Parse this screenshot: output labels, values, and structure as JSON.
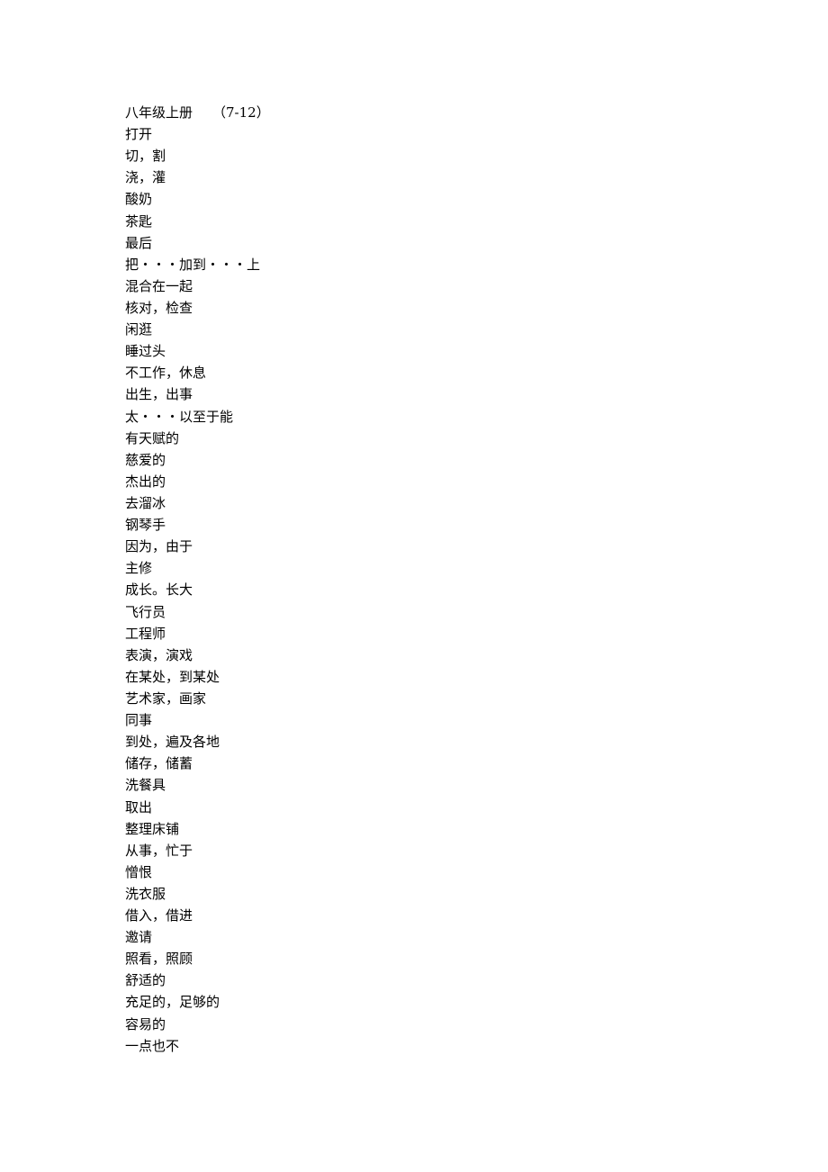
{
  "document": {
    "title": "八年级上册",
    "title_range": "（7-12）",
    "entries": [
      "打开",
      "切，割",
      "浇，灌",
      "酸奶",
      "茶匙",
      "最后",
      "把・・・加到・・・上",
      "混合在一起",
      "核对，检查",
      "闲逛",
      "睡过头",
      "不工作，休息",
      "出生，出事",
      "太・・・以至于能",
      "有天赋的",
      "慈爱的",
      "杰出的",
      "去溜冰",
      "钢琴手",
      "因为，由于",
      "主修",
      "成长。长大",
      "飞行员",
      "工程师",
      "表演，演戏",
      "在某处，到某处",
      "艺术家，画家",
      "同事",
      "到处，遍及各地",
      "储存，储蓄",
      "洗餐具",
      "取出",
      "整理床铺",
      "从事，忙于",
      "憎恨",
      "洗衣服",
      "借入，借进",
      "邀请",
      "照看，照顾",
      "舒适的",
      "充足的，足够的",
      "容易的",
      "一点也不"
    ]
  }
}
